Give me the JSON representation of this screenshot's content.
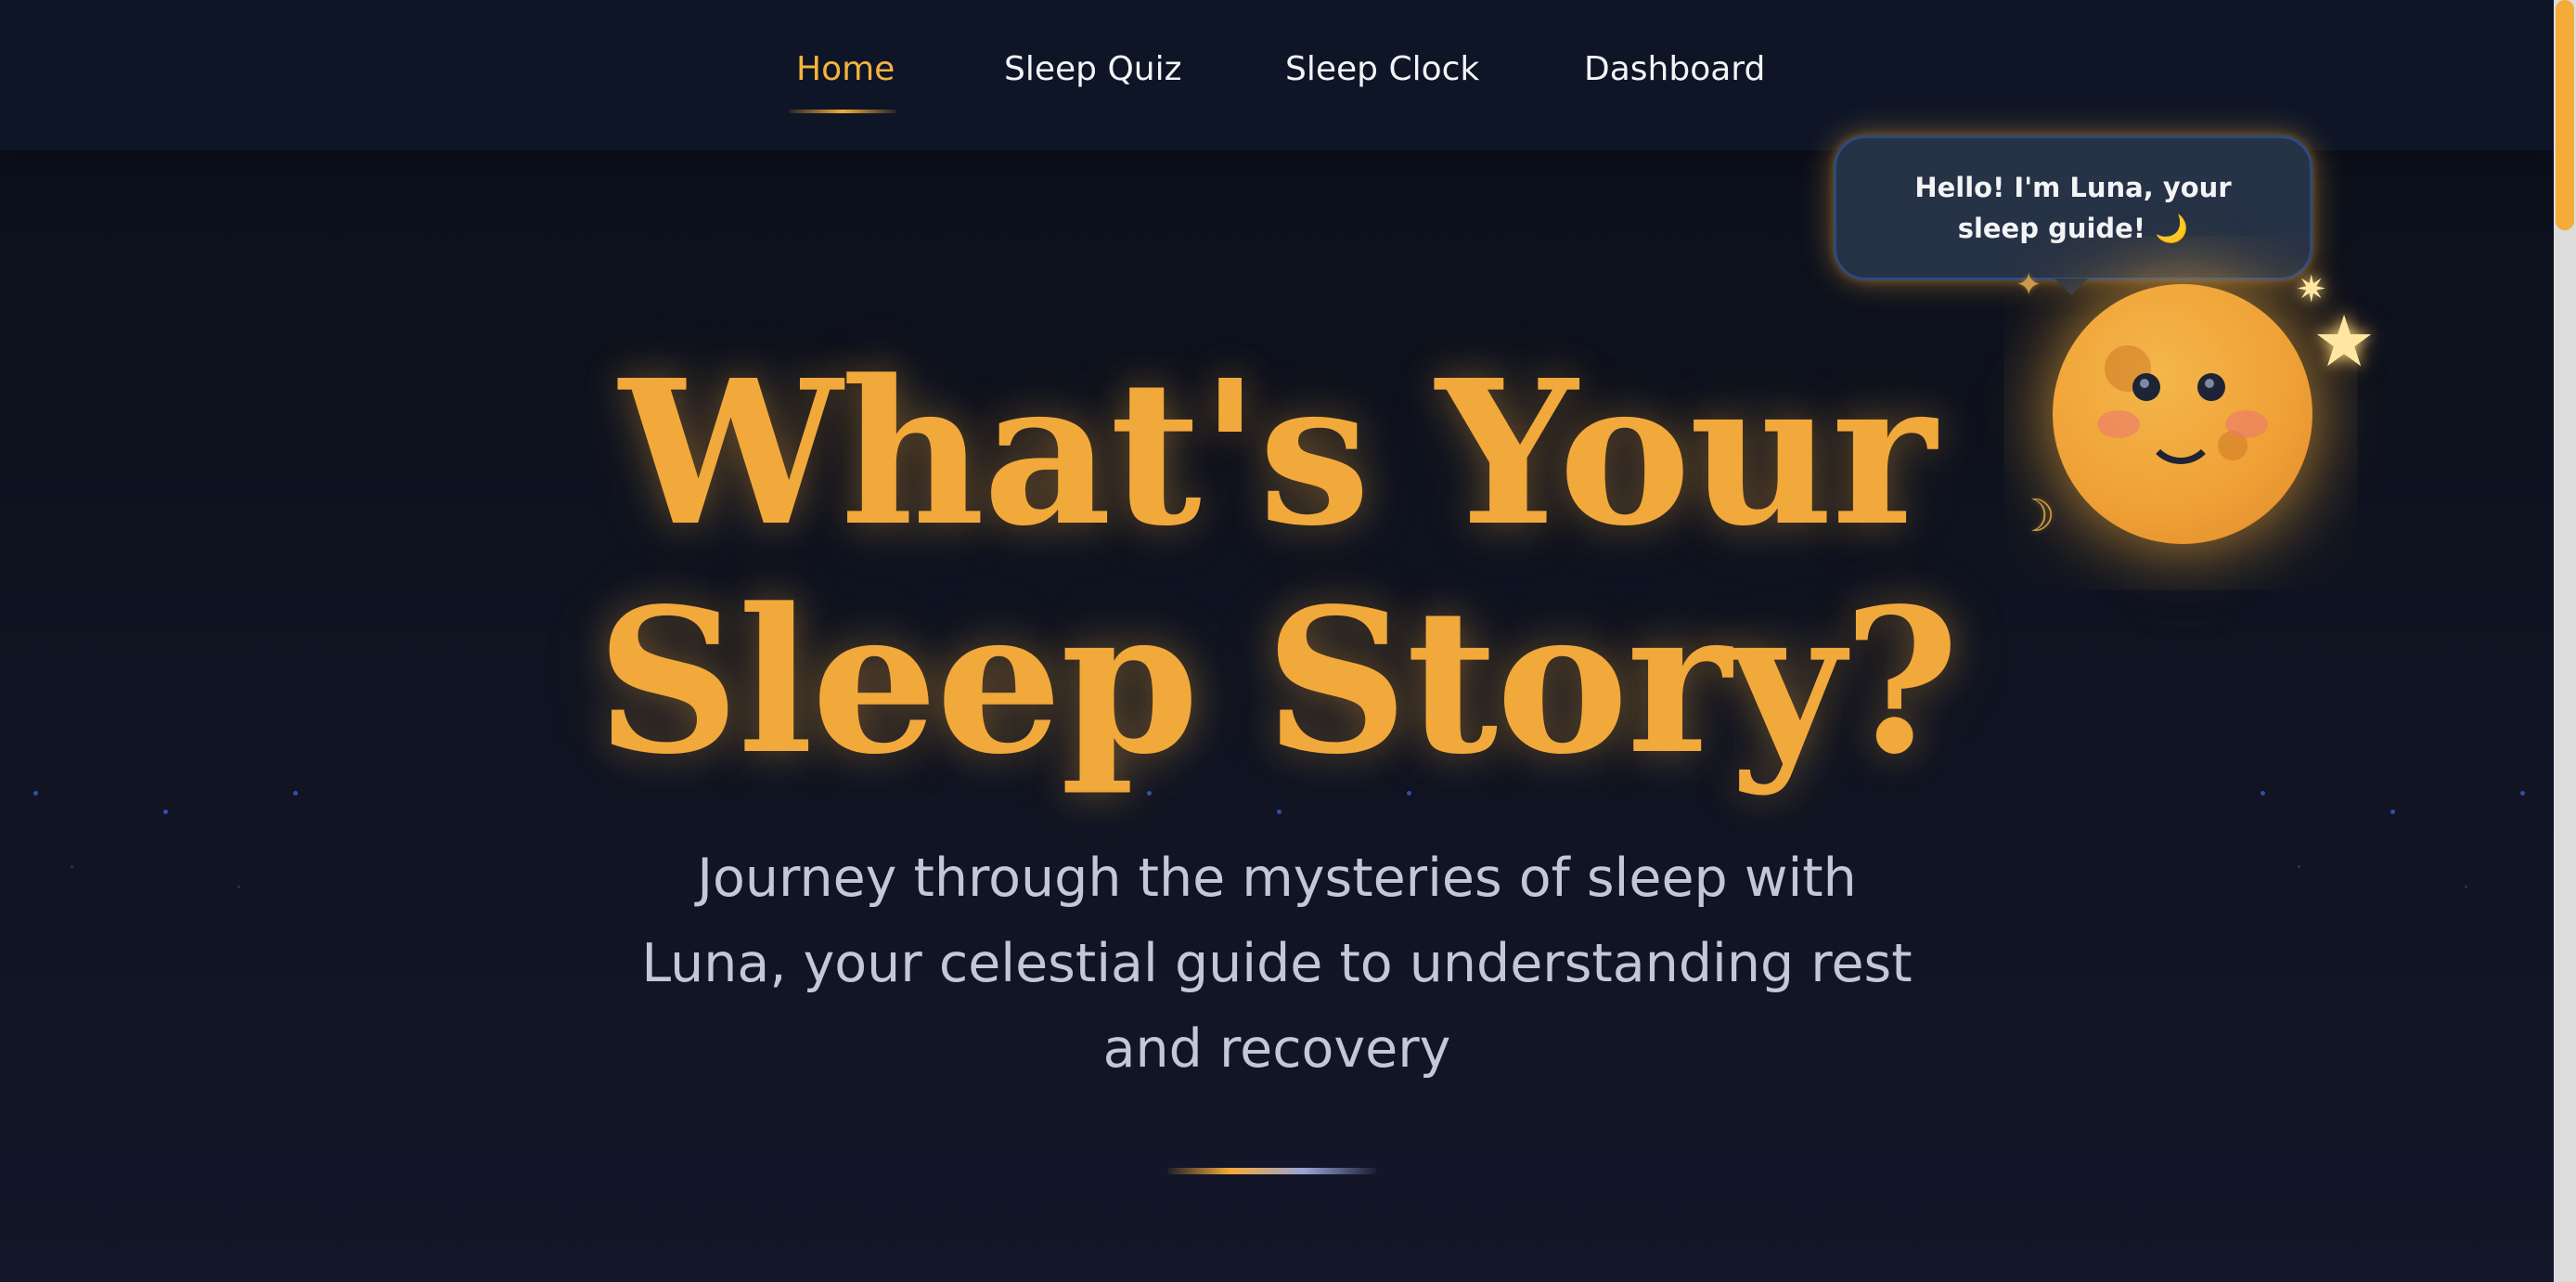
{
  "nav": {
    "items": [
      {
        "label": "Home",
        "active": true
      },
      {
        "label": "Sleep Quiz",
        "active": false
      },
      {
        "label": "Sleep Clock",
        "active": false
      },
      {
        "label": "Dashboard",
        "active": false
      }
    ]
  },
  "mascot": {
    "speech": "Hello! I'm Luna, your sleep guide! 🌙",
    "icon": "moon-mascot-icon"
  },
  "hero": {
    "title_line_1": "What's Your",
    "title_line_2": "Sleep Story?",
    "subtitle": "Journey through the mysteries of sleep with Luna, your celestial guide to understanding rest and recovery"
  },
  "colors": {
    "accent": "#f5ab38",
    "background": "#0b0f1a",
    "nav_background": "#0e1527",
    "text_muted": "#c3c8d6",
    "bubble_background": "#263246"
  }
}
